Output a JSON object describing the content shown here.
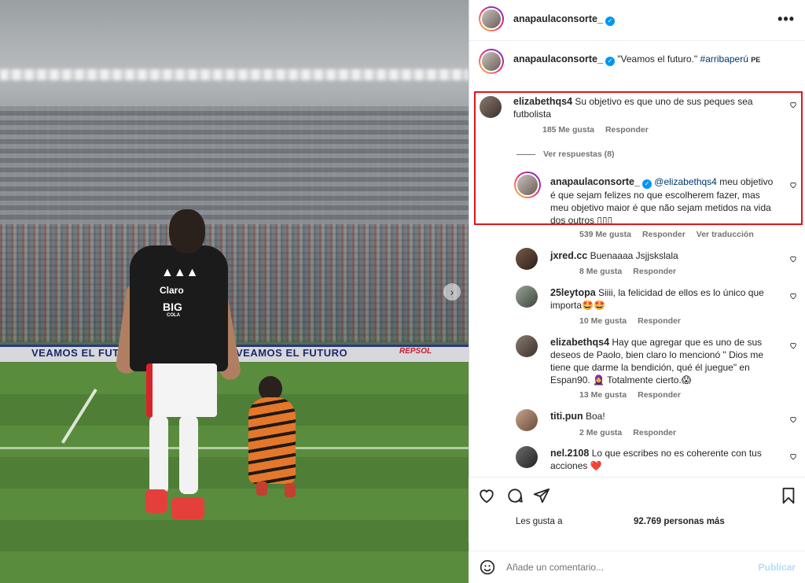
{
  "post": {
    "author": "anapaulaconsorte_",
    "more_icon": "•••",
    "caption_author": "anapaulaconsorte_",
    "caption_text": "\"Veamos el futuro.\"",
    "caption_hashtag": "#arribaperú",
    "caption_flag": "PE"
  },
  "photo": {
    "ad_text_1": "VEAMOS EL FUTURO",
    "ad_text_2": "VEAMOS EL FUTURO",
    "ad_text_3": "REPSOL",
    "shirt_brand": "Claro",
    "shirt_sponsor": "BIG",
    "shirt_sponsor_sub": "COLA",
    "next_icon": "›"
  },
  "comments": [
    {
      "user": "elizabethqs4",
      "text": "Su objetivo es que uno de sus peques sea futbolista",
      "likes": "185 Me gusta",
      "reply": "Responder"
    },
    {
      "view_replies": "Ver respuestas (8)"
    },
    {
      "user": "anapaulaconsorte_",
      "mention": "@elizabethqs4",
      "text": "meu objetivo é que sejam felizes no que escolherem fazer, mas meu objetivo maior é que não sejam metidos na vida dos outros ▯▯▯",
      "likes": "539 Me gusta",
      "reply": "Responder",
      "translate": "Ver traducción"
    },
    {
      "user": "jxred.cc",
      "text": "Buenaaaa Jsjjskslala",
      "likes": "8 Me gusta",
      "reply": "Responder"
    },
    {
      "user": "25leytopa",
      "text": "Siiii, la felicidad de ellos es lo único que importa🤩🤩",
      "likes": "10 Me gusta",
      "reply": "Responder"
    },
    {
      "user": "elizabethqs4",
      "text": "Hay que agregar que es uno de sus deseos de Paolo, bien claro lo mencionó \" Dios me tiene que darme la bendición, qué él juegue\" en Espan90. 🧕 Totalmente cierto.😱",
      "likes": "13 Me gusta",
      "reply": "Responder"
    },
    {
      "user": "titi.pun",
      "text": "Boa!",
      "likes": "2 Me gusta",
      "reply": "Responder"
    },
    {
      "user": "nel.2108",
      "text": "Lo que escribes no es coherente con tus acciones ❤️"
    }
  ],
  "actions": {
    "likes_prefix": "Les gusta a",
    "likes_count": "92.769 personas más"
  },
  "composer": {
    "placeholder": "Añade un comentario...",
    "publish": "Publicar"
  },
  "colors": {
    "highlight": "#e0151b",
    "link": "#00376b",
    "verified": "#0095f6"
  }
}
